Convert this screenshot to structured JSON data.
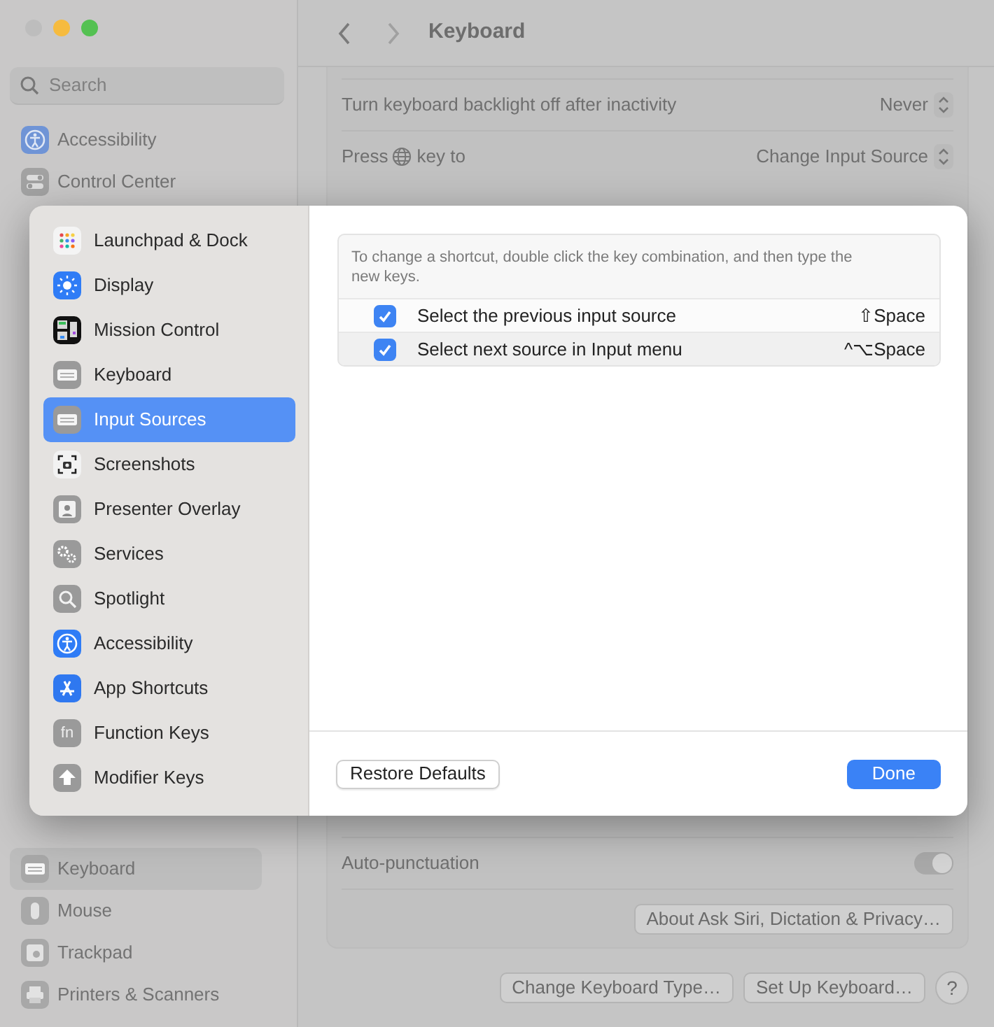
{
  "window": {
    "title": "Keyboard"
  },
  "sidebar": {
    "search": {
      "placeholder": "Search"
    },
    "items": [
      {
        "label": "Accessibility",
        "selected": false
      },
      {
        "label": "Control Center",
        "selected": false
      }
    ],
    "lower_items": [
      {
        "label": "Keyboard",
        "selected": true
      },
      {
        "label": "Mouse",
        "selected": false
      },
      {
        "label": "Trackpad",
        "selected": false
      },
      {
        "label": "Printers & Scanners",
        "selected": false
      }
    ]
  },
  "settings": [
    {
      "label": "Turn keyboard backlight off after inactivity",
      "value": "Never"
    },
    {
      "label": "Press",
      "label_after": "key to",
      "value": "Change Input Source"
    }
  ],
  "lower_settings": [
    {
      "label": "Auto-punctuation",
      "on": true
    }
  ],
  "about_button": "About Ask Siri, Dictation & Privacy…",
  "footer_buttons": [
    "Change Keyboard Type…",
    "Set Up Keyboard…"
  ],
  "help_button": "?",
  "sheet": {
    "categories": [
      {
        "label": "Launchpad & Dock",
        "selected": false
      },
      {
        "label": "Display",
        "selected": false
      },
      {
        "label": "Mission Control",
        "selected": false
      },
      {
        "label": "Keyboard",
        "selected": false
      },
      {
        "label": "Input Sources",
        "selected": true
      },
      {
        "label": "Screenshots",
        "selected": false
      },
      {
        "label": "Presenter Overlay",
        "selected": false
      },
      {
        "label": "Services",
        "selected": false
      },
      {
        "label": "Spotlight",
        "selected": false
      },
      {
        "label": "Accessibility",
        "selected": false
      },
      {
        "label": "App Shortcuts",
        "selected": false
      },
      {
        "label": "Function Keys",
        "selected": false,
        "icon_text": "fn"
      },
      {
        "label": "Modifier Keys",
        "selected": false
      }
    ],
    "note": "To change a shortcut, double click the key combination, and then type the new keys.",
    "shortcuts": [
      {
        "label": "Select the previous input source",
        "keys": "⇧Space",
        "checked": true
      },
      {
        "label": "Select next source in Input menu",
        "keys": "^⌥Space",
        "checked": true
      }
    ],
    "restore_button": "Restore Defaults",
    "done_button": "Done"
  }
}
